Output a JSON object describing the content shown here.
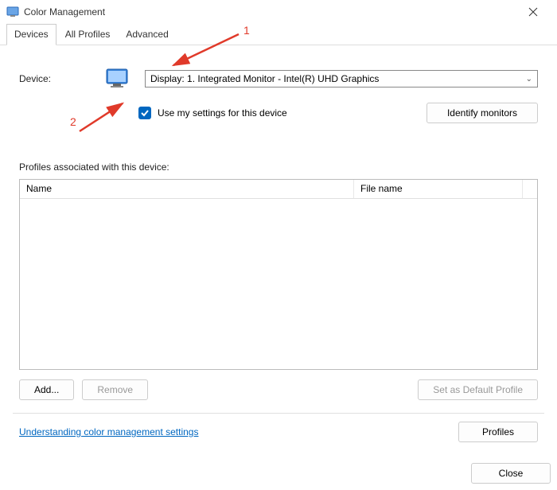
{
  "titlebar": {
    "title": "Color Management"
  },
  "tabs": {
    "devices": "Devices",
    "all_profiles": "All Profiles",
    "advanced": "Advanced"
  },
  "device": {
    "label": "Device:",
    "selected": "Display: 1. Integrated Monitor - Intel(R) UHD Graphics",
    "use_my_settings": "Use my settings for this device",
    "identify": "Identify monitors"
  },
  "profiles": {
    "label": "Profiles associated with this device:",
    "col_name": "Name",
    "col_file": "File name"
  },
  "buttons": {
    "add": "Add...",
    "remove": "Remove",
    "set_default": "Set as Default Profile",
    "profiles_btn": "Profiles",
    "close": "Close"
  },
  "link": {
    "understanding": "Understanding color management settings"
  },
  "annotations": {
    "one": "1",
    "two": "2"
  }
}
